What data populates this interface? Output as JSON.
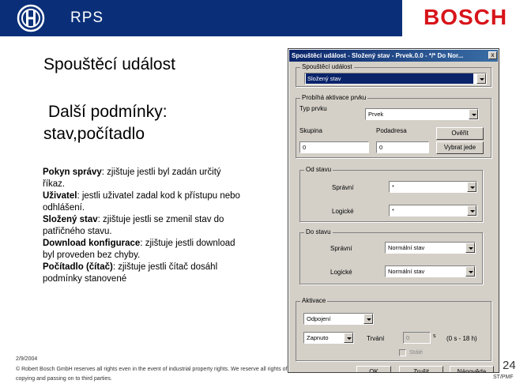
{
  "header": {
    "title": "RPS",
    "brand": "BOSCH"
  },
  "slide": {
    "heading": "Spouštěcí událost",
    "subheading_line1": "Další podmínky:",
    "subheading_line2": "stav,počítadlo",
    "notes": [
      {
        "term": "Pokyn správy",
        "text": ": zjištuje jestli byl zadán určitý říkaz."
      },
      {
        "term": "Uživatel",
        "text": ": jestli uživatel zadal kod k přístupu nebo odhlášení."
      },
      {
        "term": "Složený stav",
        "text": ": zjištuje jestli se zmenil stav do patřičného stavu."
      },
      {
        "term": "Download konfigurace",
        "text": ": zjištuje jestli download byl proveden bez chyby."
      },
      {
        "term": "Počítadlo (čítač)",
        "text": ": zjištuje jestli čítač dosáhl podmínky stanovené"
      }
    ]
  },
  "footer": {
    "date": "2/9/2004",
    "copyright_line1": "© Robert Bosch GmbH reserves all rights even in the event of industrial property rights. We reserve all rights of disposal such as",
    "copyright_line2": "copying and passing on to third parties.",
    "page": "24",
    "dept": "ST/PMF"
  },
  "dialog": {
    "title": "Spouštěcí událost - Složený stav - Prvek.0.0 - */* Do Nor...",
    "close": "x",
    "trigger_group": {
      "label": "Spouštěcí událost",
      "value": "Složený stav"
    },
    "activation_group": {
      "label": "Probíhá aktivace prvku",
      "type_label": "Typ prvku",
      "type_value": "Prvek",
      "group_label": "Skupina",
      "group_value": "0",
      "subaddress_label": "Podadresa",
      "subaddress_value": "0",
      "verify_button": "Ověřit",
      "select_button": "Vybrat jede"
    },
    "from_state": {
      "label": "Od stavu",
      "admin_label": "Správní",
      "admin_value": "*",
      "logic_label": "Logické",
      "logic_value": "*"
    },
    "to_state": {
      "label": "Do stavu",
      "admin_label": "Správní",
      "admin_value": "Normální stav",
      "logic_label": "Logické",
      "logic_value": "Normální stav"
    },
    "activation": {
      "label": "Aktivace",
      "release_value": "Odpojení",
      "switch_value": "Zapnuto",
      "duration_label": "Trvání",
      "duration_value": "0",
      "unit": "s",
      "range": "(0 s - 18 h)",
      "permanent_label": "Stálé"
    },
    "buttons": {
      "ok": "OK",
      "cancel": "Zrušit",
      "help": "Nápověda"
    }
  },
  "colors": {
    "header_bg": "#0a2f78",
    "brand_red": "#d7141a",
    "dialog_bg": "#d4d0c8",
    "selection": "#0a246a"
  }
}
